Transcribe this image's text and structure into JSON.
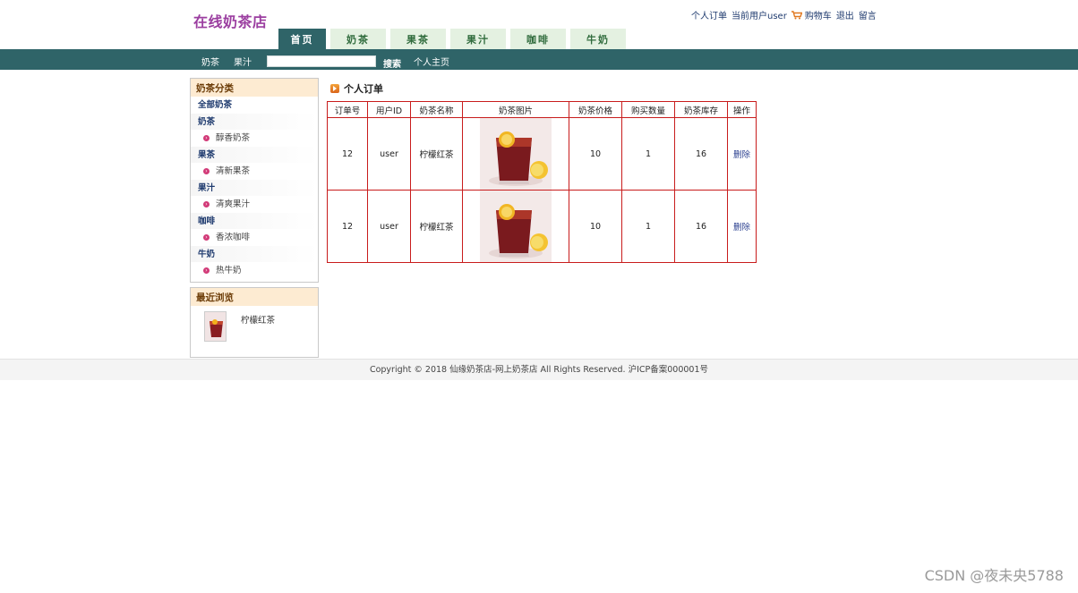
{
  "header": {
    "logo": "在线奶茶店",
    "links": {
      "orders": "个人订单",
      "current_user": "当前用户user",
      "cart": "购物车",
      "logout": "退出",
      "message": "留言"
    }
  },
  "tabs": [
    {
      "label": "首页"
    },
    {
      "label": "奶茶"
    },
    {
      "label": "果茶"
    },
    {
      "label": "果汁"
    },
    {
      "label": "咖啡"
    },
    {
      "label": "牛奶"
    }
  ],
  "navbar": {
    "links": [
      "奶茶",
      "果汁"
    ],
    "search_value": "",
    "search_button": "搜索",
    "home_link": "个人主页"
  },
  "sidebar": {
    "categories_title": "奶茶分类",
    "all_label": "全部奶茶",
    "groups": [
      {
        "name": "奶茶",
        "item": "醇香奶茶"
      },
      {
        "name": "果茶",
        "item": "清新果茶"
      },
      {
        "name": "果汁",
        "item": "清爽果汁"
      },
      {
        "name": "咖啡",
        "item": "香浓咖啡"
      },
      {
        "name": "牛奶",
        "item": "热牛奶"
      }
    ],
    "recent_title": "最近浏览",
    "recent_item": "柠檬红茶"
  },
  "main": {
    "title": "个人订单",
    "columns": [
      "订单号",
      "用户ID",
      "奶茶名称",
      "奶茶图片",
      "奶茶价格",
      "购买数量",
      "奶茶库存",
      "操作"
    ],
    "rows": [
      {
        "order_id": "12",
        "user_id": "user",
        "name": "柠檬红茶",
        "price": "10",
        "quantity": "1",
        "stock": "16",
        "action": "删除"
      },
      {
        "order_id": "12",
        "user_id": "user",
        "name": "柠檬红茶",
        "price": "10",
        "quantity": "1",
        "stock": "16",
        "action": "删除"
      }
    ]
  },
  "footer": {
    "copyright": "Copyright © 2018 仙缘奶茶店-网上奶茶店 All Rights Reserved. 沪ICP备案000001号"
  },
  "watermark": "CSDN @夜未央5788",
  "colors": {
    "nav_bg": "#2f6468",
    "tab_bg": "#e4f1e1",
    "logo": "#9b3ea0",
    "table_border": "#c81c1c",
    "panel_title_bg": "#fdebd2",
    "bullet": "#d23a78"
  }
}
